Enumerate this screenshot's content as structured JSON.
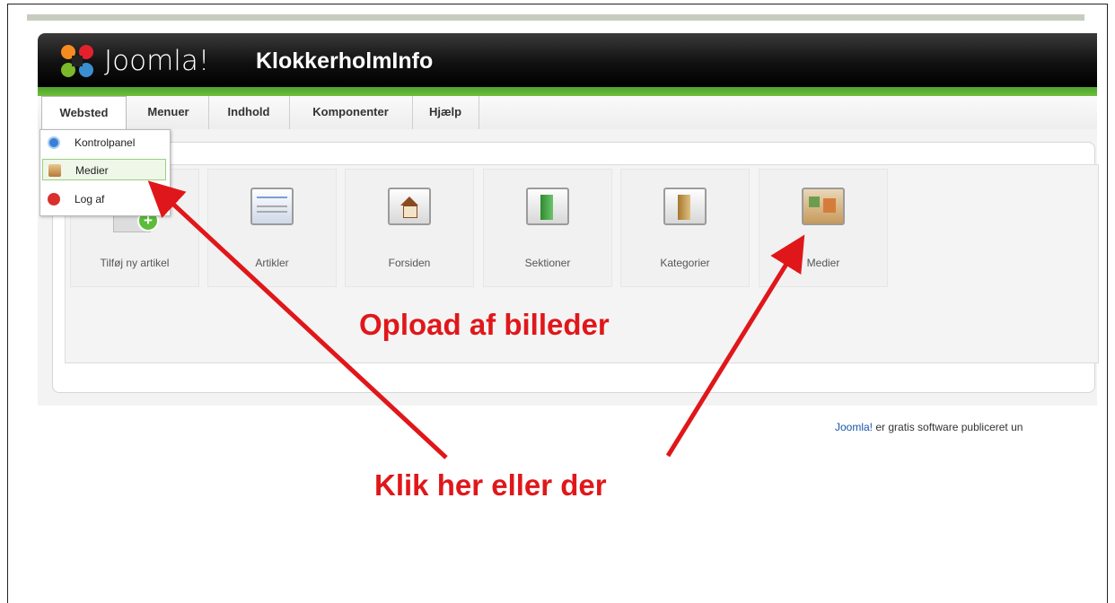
{
  "header": {
    "brand": "Joomla!",
    "site_name": "KlokkerholmInfo"
  },
  "menu": {
    "items": [
      {
        "label": "Websted"
      },
      {
        "label": "Menuer"
      },
      {
        "label": "Indhold"
      },
      {
        "label": "Komponenter"
      },
      {
        "label": "Hjælp"
      }
    ]
  },
  "dropdown": {
    "items": [
      {
        "label": "Kontrolpanel",
        "icon": "control-panel-icon"
      },
      {
        "label": "Medier",
        "icon": "media-icon"
      },
      {
        "label": "Log af",
        "icon": "logout-icon"
      }
    ]
  },
  "tiles": [
    {
      "label": "Tilføj ny artikel",
      "icon": "add-article-icon"
    },
    {
      "label": "Artikler",
      "icon": "articles-icon"
    },
    {
      "label": "Forsiden",
      "icon": "frontpage-icon"
    },
    {
      "label": "Sektioner",
      "icon": "sections-icon"
    },
    {
      "label": "Kategorier",
      "icon": "categories-icon"
    },
    {
      "label": "Medier",
      "icon": "media-icon"
    }
  ],
  "footer": {
    "link": "Joomla!",
    "text": " er gratis software publiceret un"
  },
  "annotations": {
    "upload": "Opload af billeder",
    "click": "Klik her eller der"
  },
  "colors": {
    "accent_green": "#5aab31",
    "annotation_red": "#e0171a",
    "header_black": "#111111"
  }
}
